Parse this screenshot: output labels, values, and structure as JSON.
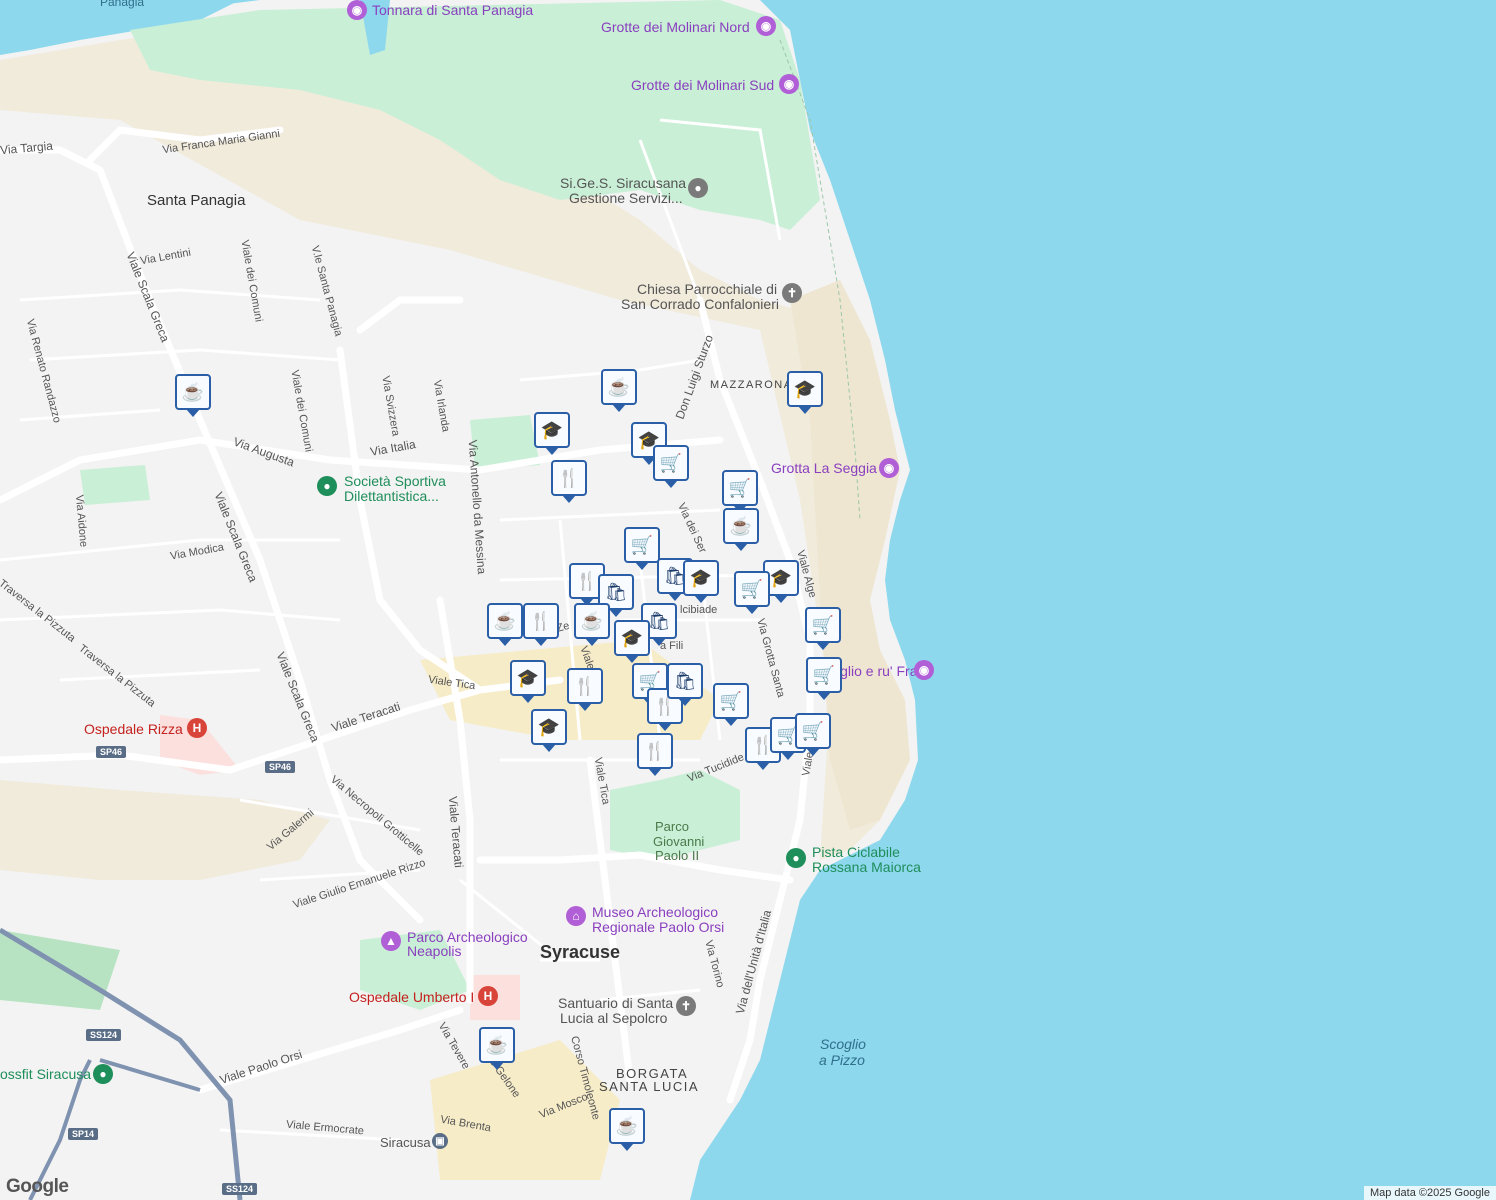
{
  "colors": {
    "sea": "#8ed8ee",
    "land": "#f3f3f3",
    "green": "#c9efd6",
    "sand": "#f1ebdc",
    "road": "#ffffff",
    "pin_border": "#2a5fa8"
  },
  "places": {
    "city": "Syracuse",
    "santa_panagia": "Santa Panagia",
    "mazzarona": "MAZZARONA",
    "borgata_1": "BORGATA",
    "borgata_2": "SANTA LUCIA",
    "panagia_top": "Panagia"
  },
  "streets": {
    "via_targia": "Via Targia",
    "via_franca": "Via Franca Maria Gianni",
    "via_lentini": "Via Lentini",
    "viale_scala_greca_1": "Viale Scala Greca",
    "viale_scala_greca_2": "Viale Scala Greca",
    "viale_scala_greca_3": "Viale Scala Greca",
    "viale_dei_comuni_1": "Viale dei Comuni",
    "viale_dei_comuni_2": "Viale dei Comuni",
    "vle_santa_panagia": "V.le Santa Panagia",
    "via_renato": "Via Renato Randazzo",
    "via_svizzera": "Via Svizzera",
    "via_irlanda": "Via Irlanda",
    "via_italia": "Via Italia",
    "via_augusta": "Via Augusta",
    "via_aidone": "Via Aidone",
    "via_modica": "Via Modica",
    "via_antonello": "Via Antonello da Messina",
    "traversa_pizzuta_1": "Traversa la Pizzuta",
    "traversa_pizzuta_2": "Traversa la Pizzuta",
    "viale_tica_1": "Viale Tica",
    "viale_tica_2": "Viale Tica",
    "viale_teracati_1": "Viale Teracati",
    "viale_teracati_2": "Viale Teracati",
    "via_necropoli": "Via Necropoli Grotticelle",
    "via_galermi": "Via Galermi",
    "viale_giulio": "Viale Giulio Emanuele Rizzo",
    "don_luigi": "Don Luigi Sturzo",
    "via_dei_servi": "Via dei Ser",
    "via_grotta_santa": "Via Grotta Santa",
    "viale_algeri": "Viale Alge",
    "via_tucidide": "Via Tucidide",
    "via_torino": "Via Torino",
    "via_unita": "Via dell'Unità d'Italia",
    "viale_paolo_orsi": "Viale Paolo Orsi",
    "via_tevere": "Via Tevere",
    "corso_gelone": "so Gelone",
    "corso_timoleonte": "Corso Timoleonte",
    "via_mosco": "Via Mosco",
    "via_brenta": "Via Brenta",
    "viale_ermocrate": "Viale Ermocrate",
    "alcibiade": "lcibiade",
    "via_fili_1": "Via Fili",
    "via_fili_2": "a Fili",
    "vle_zecchino": "V.le Ze",
    "viale_s": "Viale",
    "viale_e": "Viale"
  },
  "pois": {
    "tonnara": "Tonnara di Santa Panagia",
    "molinari_nord": "Grotte dei Molinari Nord",
    "molinari_sud": "Grotte dei Molinari Sud",
    "sigess_1": "Si.Ge.S. Siracusana",
    "sigess_2": "Gestione Servizi...",
    "chiesa_1": "Chiesa Parrocchiale di",
    "chiesa_2": "San Corrado Confalonieri",
    "grotta_seggia": "Grotta La Seggia",
    "ru_frati": "Scoglio e ru' Frati",
    "societa_1": "Società Sportiva",
    "societa_2": "Dilettantistica...",
    "ospedale_rizza": "Ospedale Rizza",
    "pista_1": "Pista Ciclabile",
    "pista_2": "Rossana Maiorca",
    "parco_1": "Parco",
    "parco_2": "Giovanni",
    "parco_3": "Paolo II",
    "museo_1": "Museo Archeologico",
    "museo_2": "Regionale Paolo Orsi",
    "neapolis_1": "Parco Archeologico",
    "neapolis_2": "Neapolis",
    "ospedale_umberto": "Ospedale Umberto I",
    "santuario_1": "Santuario di Santa",
    "santuario_2": "Lucia al Sepolcro",
    "crossfit": "ossfit Siracusa",
    "siracusa_station": "Siracusa",
    "scoglio_pizzo_1": "Scoglio",
    "scoglio_pizzo_2": "a Pizzo"
  },
  "shields": {
    "sp46_a": "SP46",
    "sp46_b": "SP46",
    "ss124_a": "SS124",
    "ss124_b": "SS124",
    "sp14": "SP14"
  },
  "markers": [
    {
      "type": "cafe",
      "icon": "☕"
    },
    {
      "type": "cafe",
      "icon": "☕"
    },
    {
      "type": "school",
      "icon": "🎓"
    },
    {
      "type": "school",
      "icon": "🎓"
    },
    {
      "type": "school",
      "icon": "🎓"
    },
    {
      "type": "grocery",
      "icon": "🛒"
    },
    {
      "type": "restaurant",
      "icon": "🍴"
    },
    {
      "type": "grocery",
      "icon": "🛒"
    },
    {
      "type": "cafe",
      "icon": "☕"
    },
    {
      "type": "grocery",
      "icon": "🛒"
    },
    {
      "type": "restaurant",
      "icon": "🍴"
    },
    {
      "type": "shopping",
      "icon": "🛍"
    },
    {
      "type": "shopping",
      "icon": "🛍"
    },
    {
      "type": "school",
      "icon": "🎓"
    },
    {
      "type": "school",
      "icon": "🎓"
    },
    {
      "type": "grocery",
      "icon": "🛒"
    },
    {
      "type": "cafe",
      "icon": "☕"
    },
    {
      "type": "restaurant",
      "icon": "🍴"
    },
    {
      "type": "cafe",
      "icon": "☕"
    },
    {
      "type": "shopping",
      "icon": "🛍"
    },
    {
      "type": "school",
      "icon": "🎓"
    },
    {
      "type": "grocery",
      "icon": "🛒"
    },
    {
      "type": "school",
      "icon": "🎓"
    },
    {
      "type": "restaurant",
      "icon": "🍴"
    },
    {
      "type": "grocery",
      "icon": "🛒"
    },
    {
      "type": "restaurant",
      "icon": "🍴"
    },
    {
      "type": "shopping",
      "icon": "🛍"
    },
    {
      "type": "grocery",
      "icon": "🛒"
    },
    {
      "type": "grocery",
      "icon": "🛒"
    },
    {
      "type": "school",
      "icon": "🎓"
    },
    {
      "type": "restaurant",
      "icon": "🍴"
    },
    {
      "type": "restaurant",
      "icon": "🍴"
    },
    {
      "type": "grocery",
      "icon": "🛒"
    },
    {
      "type": "grocery",
      "icon": "🛒"
    },
    {
      "type": "cafe",
      "icon": "☕"
    },
    {
      "type": "cafe",
      "icon": "☕"
    }
  ],
  "attribution": "Map data ©2025 Google",
  "logo": "Google"
}
